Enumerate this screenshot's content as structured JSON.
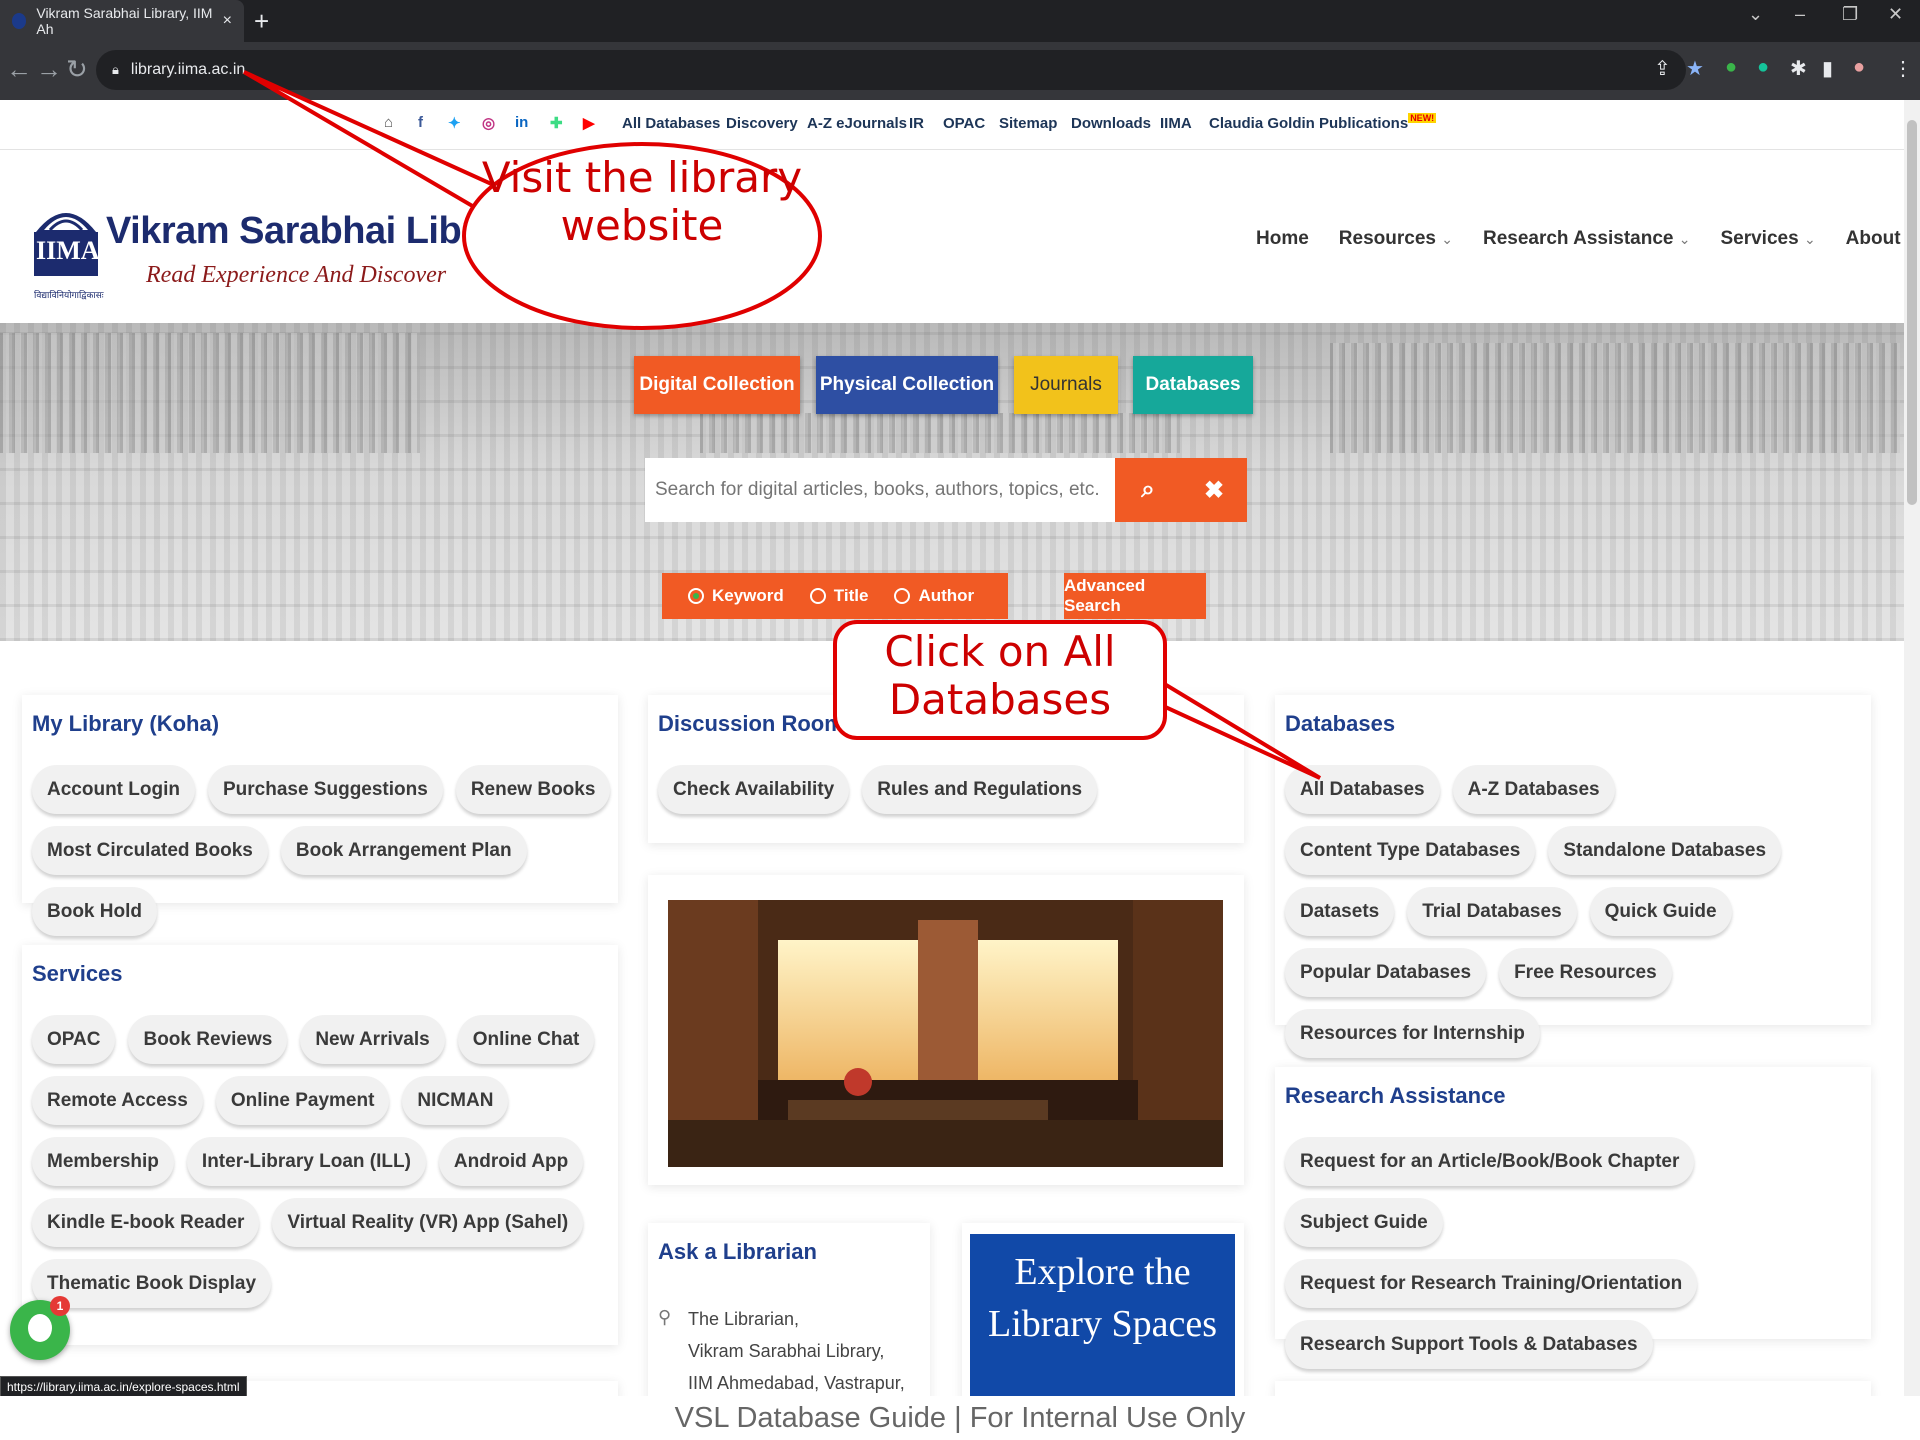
{
  "browser": {
    "tab_title": "Vikram Sarabhai Library, IIM Ah",
    "tab_close": "×",
    "new_tab": "+",
    "url": "library.iima.ac.in",
    "window_controls": {
      "minimize": "–",
      "maximize": "❐",
      "close": "✕",
      "dropdown": "⌄"
    }
  },
  "top_links": [
    "All Databases",
    "Discovery",
    "A-Z eJournals",
    "IR",
    "OPAC",
    "Sitemap",
    "Downloads",
    "IIMA"
  ],
  "top_link_special": {
    "label": "Claudia Goldin Publications",
    "badge": "NEW!"
  },
  "logo": {
    "mark": "IIMA",
    "title": "Vikram Sarabhai Library",
    "tagline": "Read Experience And Discover",
    "small": "विद्याविनियोगाद्विकासः"
  },
  "main_nav": [
    "Home",
    "Resources",
    "Research Assistance",
    "Services",
    "About"
  ],
  "hero": {
    "categories": [
      {
        "label": "Digital Collection",
        "color": "#f15a24"
      },
      {
        "label": "Physical Collection",
        "color": "#2e4fa3"
      },
      {
        "label": "Journals",
        "color": "#f2c21b"
      },
      {
        "label": "Databases",
        "color": "#16a89a"
      }
    ],
    "search_placeholder": "Search for digital articles, books, authors, topics, etc.",
    "radios": [
      "Keyword",
      "Title",
      "Author"
    ],
    "advanced_search": "Advanced Search"
  },
  "cards": {
    "my_library": {
      "title": "My Library (Koha)",
      "items": [
        "Account Login",
        "Purchase Suggestions",
        "Renew Books",
        "Most Circulated Books",
        "Book Arrangement Plan",
        "Book Hold"
      ]
    },
    "services": {
      "title": "Services",
      "items": [
        "OPAC",
        "Book Reviews",
        "New Arrivals",
        "Online Chat",
        "Remote Access",
        "Online Payment",
        "NICMAN",
        "Membership",
        "Inter-Library Loan (ILL)",
        "Android App",
        "Kindle E-book Reader",
        "Virtual Reality (VR) App (Sahel)",
        "Thematic Book Display"
      ]
    },
    "discussion_rooms": {
      "title": "Discussion Rooms",
      "items": [
        "Check Availability",
        "Rules and Regulations"
      ]
    },
    "databases": {
      "title": "Databases",
      "items": [
        "All Databases",
        "A-Z Databases",
        "Content Type Databases",
        "Standalone Databases",
        "Datasets",
        "Trial Databases",
        "Quick Guide",
        "Popular Databases",
        "Free Resources",
        "Resources for Internship"
      ]
    },
    "research_assistance": {
      "title": "Research Assistance",
      "items": [
        "Request for an Article/Book/Book Chapter",
        "Subject Guide",
        "Request for Research Training/Orientation",
        "Research Support Tools & Databases"
      ]
    },
    "ask_librarian": {
      "title": "Ask a Librarian",
      "address": [
        "The Librarian,",
        "Vikram Sarabhai Library,",
        "IIM Ahmedabad, Vastrapur,"
      ]
    }
  },
  "explore": "Explore the Library Spaces",
  "status_url": "https://library.iima.ac.in/explore-spaces.html",
  "chat_badge": "1",
  "annotations": {
    "visit": "Visit the library website",
    "click": "Click on All Databases"
  },
  "footer_caption": "VSL Database Guide | For Internal Use Only",
  "colors": {
    "accent_orange": "#f15a24",
    "brand_blue": "#1f3f8c",
    "annotation_red": "#e00000"
  }
}
